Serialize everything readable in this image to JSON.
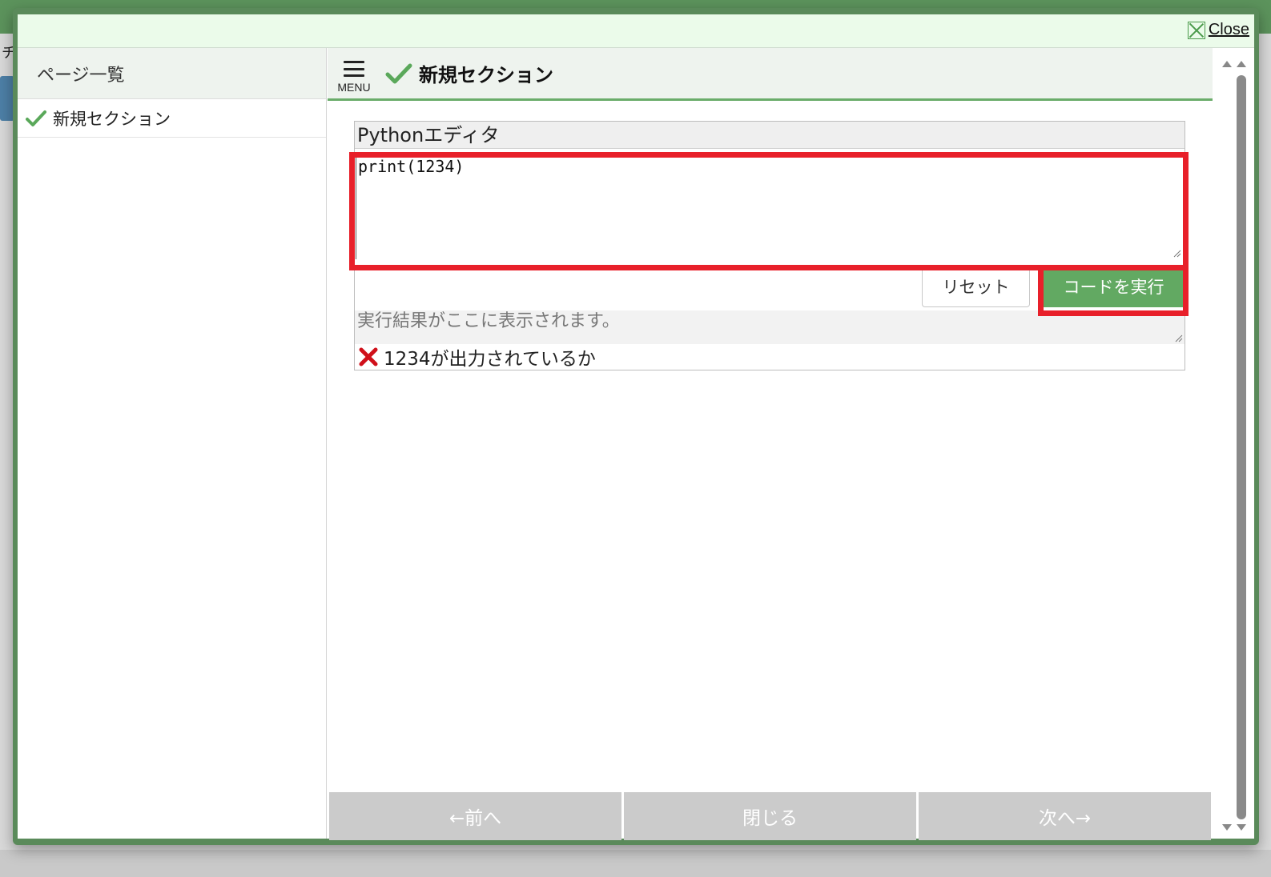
{
  "dialog": {
    "close_label": "Close"
  },
  "background": {
    "edge_char": "チ"
  },
  "sidebar": {
    "header": "ページ一覧",
    "items": [
      {
        "label": "新規セクション",
        "completed": true
      }
    ]
  },
  "main": {
    "menu_label": "MENU",
    "section_title": "新規セクション",
    "editor": {
      "title": "Pythonエディタ",
      "code": "print(1234)",
      "reset_label": "リセット",
      "run_label": "コードを実行",
      "output_placeholder": "実行結果がここに表示されます。",
      "check_status": "fail",
      "check_label": "1234が出力されているか"
    }
  },
  "footer": {
    "prev_label": "←前へ",
    "close_label": "閉じる",
    "next_label": "次へ→"
  },
  "colors": {
    "accent_green": "#62a962",
    "highlight_red": "#e8202a",
    "check_green": "#5aa85a",
    "fail_red": "#d0101a"
  }
}
